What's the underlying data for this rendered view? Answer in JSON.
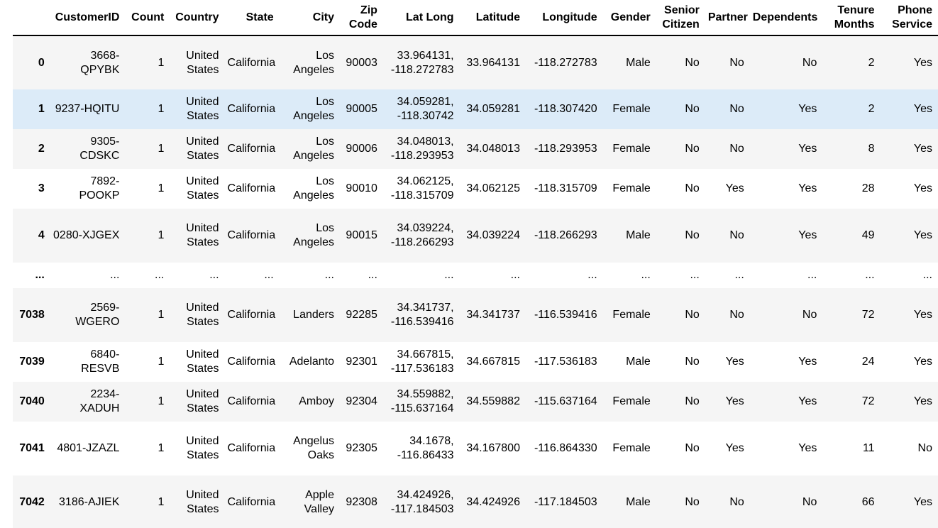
{
  "table": {
    "columns": [
      {
        "label": "",
        "width": 52
      },
      {
        "label": "CustomerID",
        "width": 104
      },
      {
        "label": "Count",
        "width": 62
      },
      {
        "label": "Country",
        "width": 76
      },
      {
        "label": "State",
        "width": 76
      },
      {
        "label": "City",
        "width": 84
      },
      {
        "label": "Zip Code",
        "width": 60
      },
      {
        "label": "Lat Long",
        "width": 106
      },
      {
        "label": "Latitude",
        "width": 92
      },
      {
        "label": "Longitude",
        "width": 107
      },
      {
        "label": "Gender",
        "width": 74
      },
      {
        "label": "Senior Citizen",
        "width": 68
      },
      {
        "label": "Partner",
        "width": 62
      },
      {
        "label": "Dependents",
        "width": 101
      },
      {
        "label": "Tenure Months",
        "width": 80
      },
      {
        "label": "Phone Service",
        "width": 80
      }
    ],
    "rows": [
      {
        "index": "0",
        "cells": [
          "3668-QPYBK",
          "1",
          "United States",
          "California",
          "Los Angeles",
          "90003",
          "33.964131, -118.272783",
          "33.964131",
          "-118.272783",
          "Male",
          "No",
          "No",
          "No",
          "2",
          "Yes"
        ],
        "height": 76,
        "style": "odd"
      },
      {
        "index": "1",
        "cells": [
          "9237-HQITU",
          "1",
          "United States",
          "California",
          "Los Angeles",
          "90005",
          "34.059281, -118.30742",
          "34.059281",
          "-118.307420",
          "Female",
          "No",
          "No",
          "Yes",
          "2",
          "Yes"
        ],
        "height": 56,
        "style": "hover"
      },
      {
        "index": "2",
        "cells": [
          "9305-CDSKC",
          "1",
          "United States",
          "California",
          "Los Angeles",
          "90006",
          "34.048013, -118.293953",
          "34.048013",
          "-118.293953",
          "Female",
          "No",
          "No",
          "Yes",
          "8",
          "Yes"
        ],
        "height": 56,
        "style": "odd"
      },
      {
        "index": "3",
        "cells": [
          "7892-POOKP",
          "1",
          "United States",
          "California",
          "Los Angeles",
          "90010",
          "34.062125, -118.315709",
          "34.062125",
          "-118.315709",
          "Female",
          "No",
          "Yes",
          "Yes",
          "28",
          "Yes"
        ],
        "height": 56,
        "style": "even"
      },
      {
        "index": "4",
        "cells": [
          "0280-XJGEX",
          "1",
          "United States",
          "California",
          "Los Angeles",
          "90015",
          "34.039224, -118.266293",
          "34.039224",
          "-118.266293",
          "Male",
          "No",
          "No",
          "Yes",
          "49",
          "Yes"
        ],
        "height": 76,
        "style": "odd"
      },
      {
        "index": "...",
        "cells": [
          "...",
          "...",
          "...",
          "...",
          "...",
          "...",
          "...",
          "...",
          "...",
          "...",
          "...",
          "...",
          "...",
          "...",
          "..."
        ],
        "height": 36,
        "style": "even"
      },
      {
        "index": "7038",
        "cells": [
          "2569-WGERO",
          "1",
          "United States",
          "California",
          "Landers",
          "92285",
          "34.341737, -116.539416",
          "34.341737",
          "-116.539416",
          "Female",
          "No",
          "No",
          "No",
          "72",
          "Yes"
        ],
        "height": 76,
        "style": "odd"
      },
      {
        "index": "7039",
        "cells": [
          "6840-RESVB",
          "1",
          "United States",
          "California",
          "Adelanto",
          "92301",
          "34.667815, -117.536183",
          "34.667815",
          "-117.536183",
          "Male",
          "No",
          "Yes",
          "Yes",
          "24",
          "Yes"
        ],
        "height": 56,
        "style": "even"
      },
      {
        "index": "7040",
        "cells": [
          "2234-XADUH",
          "1",
          "United States",
          "California",
          "Amboy",
          "92304",
          "34.559882, -115.637164",
          "34.559882",
          "-115.637164",
          "Female",
          "No",
          "Yes",
          "Yes",
          "72",
          "Yes"
        ],
        "height": 56,
        "style": "odd"
      },
      {
        "index": "7041",
        "cells": [
          "4801-JZAZL",
          "1",
          "United States",
          "California",
          "Angelus Oaks",
          "92305",
          "34.1678, -116.86433",
          "34.167800",
          "-116.864330",
          "Female",
          "No",
          "Yes",
          "Yes",
          "11",
          "No"
        ],
        "height": 76,
        "style": "even"
      },
      {
        "index": "7042",
        "cells": [
          "3186-AJIEK",
          "1",
          "United States",
          "California",
          "Apple Valley",
          "92308",
          "34.424926, -117.184503",
          "34.424926",
          "-117.184503",
          "Male",
          "No",
          "No",
          "No",
          "66",
          "Yes"
        ],
        "height": 76,
        "style": "odd"
      }
    ]
  }
}
